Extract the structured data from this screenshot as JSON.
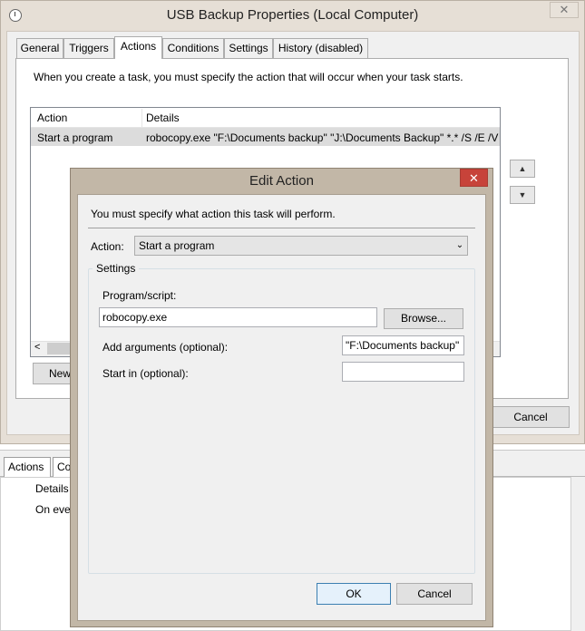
{
  "background": {
    "tabs": [
      "Actions",
      "Co"
    ],
    "columns": [
      "Details"
    ],
    "rows": [
      "On eve"
    ]
  },
  "properties": {
    "title": "USB Backup Properties (Local Computer)",
    "close_glyph": "✕",
    "tabs": [
      {
        "label": "General"
      },
      {
        "label": "Triggers"
      },
      {
        "label": "Actions",
        "active": true
      },
      {
        "label": "Conditions"
      },
      {
        "label": "Settings"
      },
      {
        "label": "History (disabled)"
      }
    ],
    "description": "When you create a task, you must specify the action that will occur when your task starts.",
    "list": {
      "columns": [
        "Action",
        "Details"
      ],
      "rows": [
        {
          "action": "Start a program",
          "details": "robocopy.exe \"F:\\Documents backup\" \"J:\\Documents Backup\" *.* /S /E /V"
        }
      ]
    },
    "new_button": "New",
    "cancel_button": "Cancel",
    "scroll_left": "<",
    "move_up": "▲",
    "move_down": "▼"
  },
  "edit_action": {
    "title": "Edit Action",
    "close_glyph": "✕",
    "instruction": "You must specify what action this task will perform.",
    "action_label": "Action:",
    "action_value": "Start a program",
    "dropdown_arrow": "⌄",
    "settings_label": "Settings",
    "program_label": "Program/script:",
    "program_value": "robocopy.exe",
    "browse_button": "Browse...",
    "arguments_label": "Add arguments (optional):",
    "arguments_value": "\"F:\\Documents backup\"",
    "start_in_label": "Start in (optional):",
    "start_in_value": "",
    "ok_button": "OK",
    "cancel_button": "Cancel"
  }
}
